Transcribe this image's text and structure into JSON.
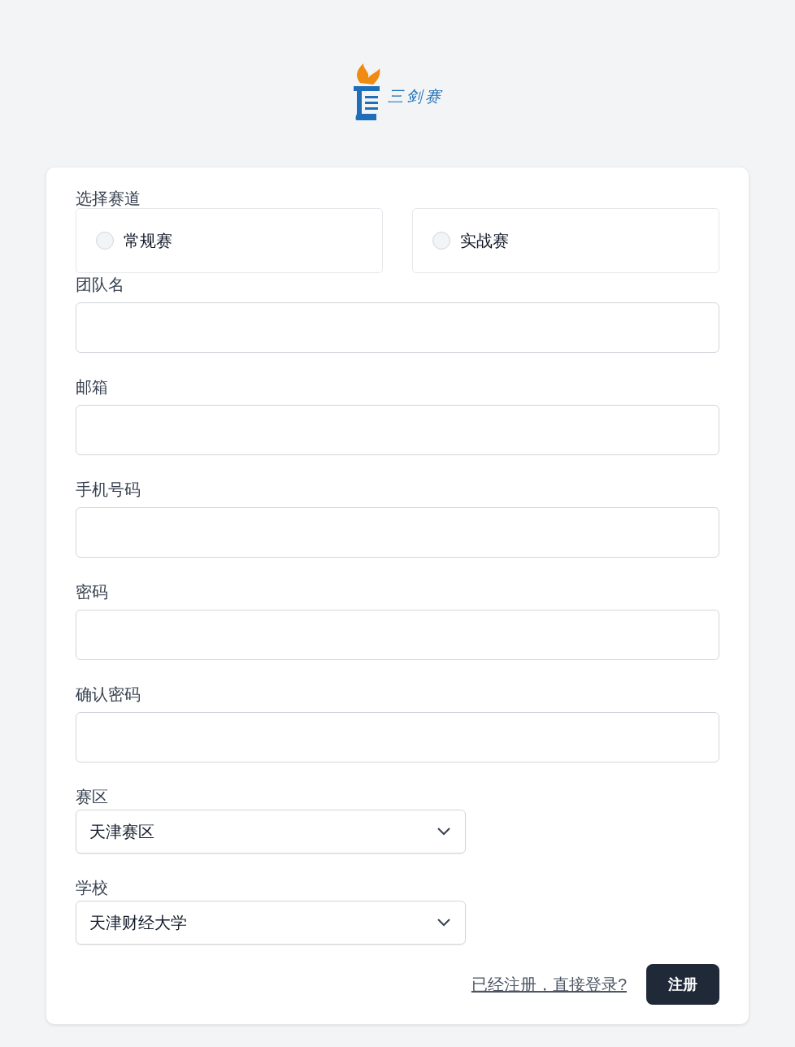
{
  "logo": {
    "text": "三剑赛"
  },
  "track": {
    "label": "选择赛道",
    "options": [
      {
        "label": "常规赛",
        "selected": false
      },
      {
        "label": "实战赛",
        "selected": false
      }
    ]
  },
  "fields": [
    {
      "label": "团队名"
    },
    {
      "label": "邮箱"
    },
    {
      "label": "手机号码"
    },
    {
      "label": "密码"
    },
    {
      "label": "确认密码"
    }
  ],
  "selects": [
    {
      "label": "赛区",
      "value": "天津赛区"
    },
    {
      "label": "学校",
      "value": "天津财经大学"
    }
  ],
  "login_link": "已经注册，直接登录?",
  "submit": "注册"
}
